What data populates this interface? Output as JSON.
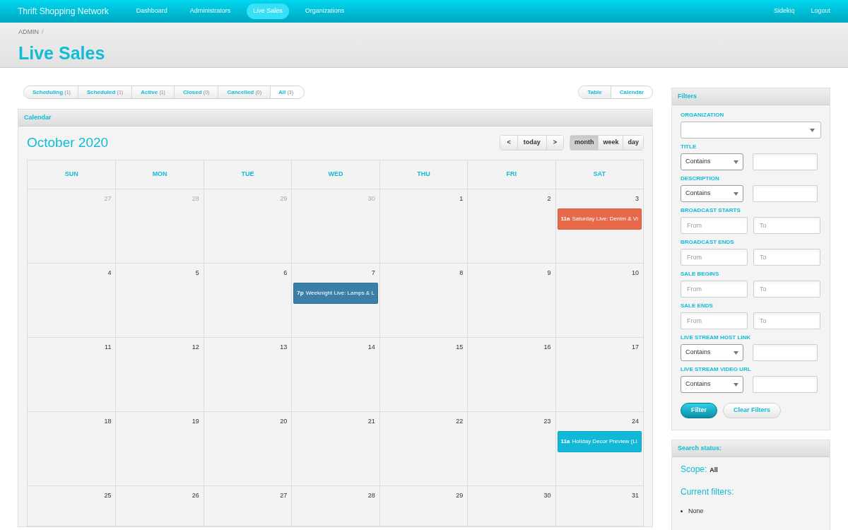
{
  "navbar": {
    "brand": "Thrift Shopping Network",
    "links": [
      {
        "label": "Dashboard",
        "selected": false
      },
      {
        "label": "Administrators",
        "selected": false
      },
      {
        "label": "Live Sales",
        "selected": true
      },
      {
        "label": "Organizations",
        "selected": false
      }
    ],
    "right_links": [
      "Sidekiq",
      "Logout"
    ]
  },
  "breadcrumb": [
    "ADMIN",
    "/"
  ],
  "page_title": "Live Sales",
  "scopes": [
    {
      "label": "Scheduling",
      "count": "(1)",
      "selected": false
    },
    {
      "label": "Scheduled",
      "count": "(1)",
      "selected": false
    },
    {
      "label": "Active",
      "count": "(1)",
      "selected": false
    },
    {
      "label": "Closed",
      "count": "(0)",
      "selected": false
    },
    {
      "label": "Cancelled",
      "count": "(0)",
      "selected": false
    },
    {
      "label": "All",
      "count": "(3)",
      "selected": true
    }
  ],
  "views": [
    {
      "label": "Table",
      "selected": false
    },
    {
      "label": "Calendar",
      "selected": true
    }
  ],
  "calendar": {
    "panel_title": "Calendar",
    "month_title": "October 2020",
    "nav": {
      "prev": "<",
      "today": "today",
      "next": ">"
    },
    "modes": [
      {
        "label": "month",
        "selected": true
      },
      {
        "label": "week",
        "selected": false
      },
      {
        "label": "day",
        "selected": false
      }
    ],
    "weekdays": [
      "SUN",
      "MON",
      "TUE",
      "WED",
      "THU",
      "FRI",
      "SAT"
    ],
    "weeks": [
      [
        {
          "day": "27",
          "other_month": true
        },
        {
          "day": "28",
          "other_month": true
        },
        {
          "day": "29",
          "other_month": true
        },
        {
          "day": "30",
          "other_month": true
        },
        {
          "day": "1",
          "other_month": false
        },
        {
          "day": "2",
          "other_month": false
        },
        {
          "day": "3",
          "other_month": false,
          "events": [
            {
              "time": "11a",
              "title": "Saturday Live: Denim & Vi",
              "color": "#e8694a"
            }
          ]
        }
      ],
      [
        {
          "day": "4",
          "other_month": false
        },
        {
          "day": "5",
          "other_month": false
        },
        {
          "day": "6",
          "other_month": false
        },
        {
          "day": "7",
          "other_month": false,
          "events": [
            {
              "time": "7p",
              "title": "Weeknight Live: Lamps & L",
              "color": "#3a7fa8"
            }
          ]
        },
        {
          "day": "8",
          "other_month": false
        },
        {
          "day": "9",
          "other_month": false
        },
        {
          "day": "10",
          "other_month": false
        }
      ],
      [
        {
          "day": "11",
          "other_month": false
        },
        {
          "day": "12",
          "other_month": false
        },
        {
          "day": "13",
          "other_month": false
        },
        {
          "day": "14",
          "other_month": false
        },
        {
          "day": "15",
          "other_month": false
        },
        {
          "day": "16",
          "other_month": false
        },
        {
          "day": "17",
          "other_month": false
        }
      ],
      [
        {
          "day": "18",
          "other_month": false
        },
        {
          "day": "19",
          "other_month": false
        },
        {
          "day": "20",
          "other_month": false
        },
        {
          "day": "21",
          "other_month": false
        },
        {
          "day": "22",
          "other_month": false
        },
        {
          "day": "23",
          "other_month": false
        },
        {
          "day": "24",
          "other_month": false,
          "events": [
            {
              "time": "11a",
              "title": "Holiday Decor Preview (Li",
              "color": "#12b8d8"
            }
          ]
        }
      ],
      [
        {
          "day": "25",
          "other_month": false
        },
        {
          "day": "26",
          "other_month": false
        },
        {
          "day": "27",
          "other_month": false
        },
        {
          "day": "28",
          "other_month": false
        },
        {
          "day": "29",
          "other_month": false
        },
        {
          "day": "30",
          "other_month": false
        },
        {
          "day": "31",
          "other_month": false
        }
      ]
    ]
  },
  "filters": {
    "title": "Filters",
    "fields": [
      {
        "kind": "select",
        "label": "ORGANIZATION"
      },
      {
        "kind": "match",
        "label": "TITLE",
        "operator": "Contains"
      },
      {
        "kind": "match",
        "label": "DESCRIPTION",
        "operator": "Contains"
      },
      {
        "kind": "range",
        "label": "BROADCAST STARTS",
        "from_placeholder": "From",
        "to_placeholder": "To"
      },
      {
        "kind": "range",
        "label": "BROADCAST ENDS",
        "from_placeholder": "From",
        "to_placeholder": "To"
      },
      {
        "kind": "range",
        "label": "SALE BEGINS",
        "from_placeholder": "From",
        "to_placeholder": "To"
      },
      {
        "kind": "range",
        "label": "SALE ENDS",
        "from_placeholder": "From",
        "to_placeholder": "To"
      },
      {
        "kind": "match",
        "label": "LIVE STREAM HOST LINK",
        "operator": "Contains"
      },
      {
        "kind": "match",
        "label": "LIVE STREAM VIDEO URL",
        "operator": "Contains"
      }
    ],
    "buttons": [
      "Filter",
      "Clear Filters"
    ]
  },
  "search_status": {
    "title": "Search status:",
    "scope_label": "Scope:",
    "scope_value": "All",
    "current_filters_label": "Current filters:",
    "current_filters": [
      "None"
    ]
  }
}
